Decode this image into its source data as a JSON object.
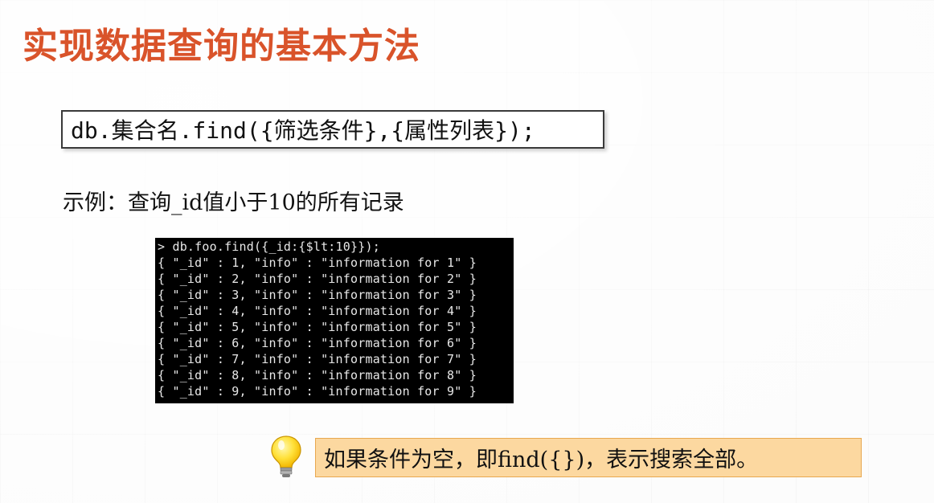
{
  "slide": {
    "title": "实现数据查询的基本方法",
    "syntax": "db.集合名.find({筛选条件},{属性列表});",
    "example_label": "示例：查询_id值小于10的所有记录",
    "terminal": {
      "lines": [
        "> db.foo.find({_id:{$lt:10}});",
        "{ \"_id\" : 1, \"info\" : \"information for 1\" }",
        "{ \"_id\" : 2, \"info\" : \"information for 2\" }",
        "{ \"_id\" : 3, \"info\" : \"information for 3\" }",
        "{ \"_id\" : 4, \"info\" : \"information for 4\" }",
        "{ \"_id\" : 5, \"info\" : \"information for 5\" }",
        "{ \"_id\" : 6, \"info\" : \"information for 6\" }",
        "{ \"_id\" : 7, \"info\" : \"information for 7\" }",
        "{ \"_id\" : 8, \"info\" : \"information for 8\" }",
        "{ \"_id\" : 9, \"info\" : \"information for 9\" }"
      ]
    },
    "tip": "如果条件为空，即find({})，表示搜索全部。",
    "icon": "lightbulb-icon",
    "colors": {
      "title": "#d9532a",
      "tip_background": "#fcd8a0",
      "terminal_background": "#000000"
    }
  }
}
